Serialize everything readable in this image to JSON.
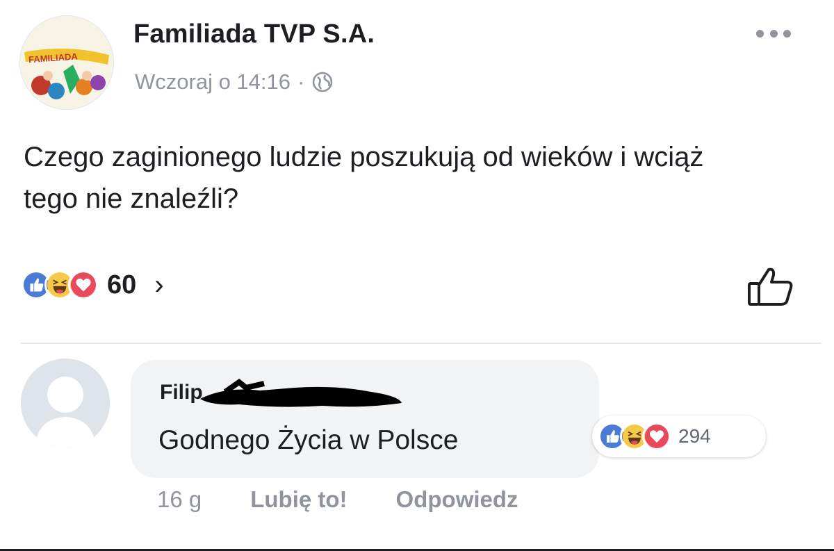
{
  "post": {
    "page_name": "Familiada TVP S.A.",
    "avatar_logo_text": "FAMILIADA",
    "timestamp": "Wczoraj o 14:16",
    "meta_separator": "·",
    "privacy_icon": "globe-icon",
    "text": "Czego zaginionego ludzie poszukują od wieków i wciąż tego nie znaleźli?",
    "reactions": {
      "icons": [
        "like-reaction-icon",
        "haha-reaction-icon",
        "love-reaction-icon"
      ],
      "count": "60",
      "more_glyph": "›"
    }
  },
  "comment": {
    "author": "Filip",
    "text": "Godnego Życia w Polsce",
    "reactions": {
      "icons": [
        "like-reaction-icon",
        "haha-reaction-icon",
        "love-reaction-icon"
      ],
      "count": "294"
    },
    "time": "16 g",
    "like_label": "Lubię to!",
    "reply_label": "Odpowiedz"
  },
  "colors": {
    "like_blue": "#4a7bd6",
    "love_red": "#e8495b",
    "haha_yellow": "#f7c948",
    "meta_gray": "#90949c",
    "bubble_gray": "#f2f3f5"
  }
}
